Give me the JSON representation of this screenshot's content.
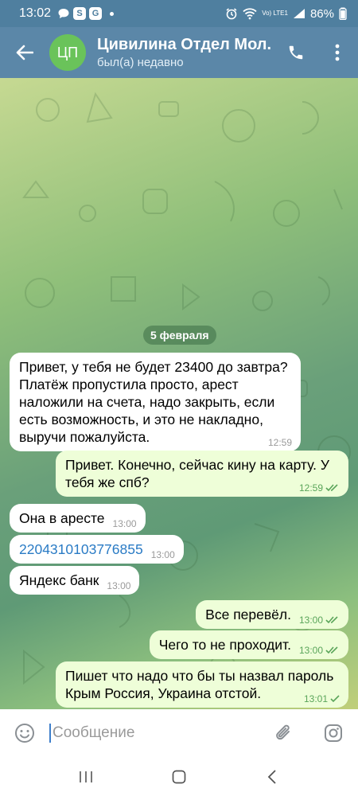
{
  "status_bar": {
    "time": "13:02",
    "left_icons": [
      "S",
      "G"
    ],
    "network": "Vo) LTE1",
    "battery": "86%"
  },
  "header": {
    "avatar_initials": "ЦП",
    "avatar_color": "#6ac35a",
    "title": "Цивилина Отдел Мол. П",
    "status": "был(а) недавно"
  },
  "chat": {
    "date": "5 февраля",
    "messages": [
      {
        "text": "Привет, у тебя не будет 23400 до завтра? Платёж пропустила просто, арест наложили на счета, надо закрыть, если есть возможность, и это не накладно, выручи пожалуйста.",
        "time": "12:59",
        "dir": "in"
      },
      {
        "text": "Привет. Конечно, сейчас кину на карту. У тебя же спб?",
        "time": "12:59",
        "dir": "out"
      },
      {
        "text": "Она в аресте",
        "time": "13:00",
        "dir": "in"
      },
      {
        "text": "2204310103776855",
        "time": "13:00",
        "dir": "in"
      },
      {
        "text": "Яндекс банк",
        "time": "13:00",
        "dir": "in"
      },
      {
        "text": "Все перевёл.",
        "time": "13:00",
        "dir": "out"
      },
      {
        "text": "Чего то не проходит.",
        "time": "13:00",
        "dir": "out"
      },
      {
        "text": "Пишет что надо что бы ты назвал пароль Крым Россия, Украина отстой.",
        "time": "13:01",
        "dir": "out"
      }
    ]
  },
  "composer": {
    "placeholder": "Сообщение"
  },
  "colors": {
    "header": "#5b87a8",
    "incoming_bubble": "#ffffff",
    "outgoing_bubble": "#eefed8",
    "link": "#2a7bc5"
  }
}
